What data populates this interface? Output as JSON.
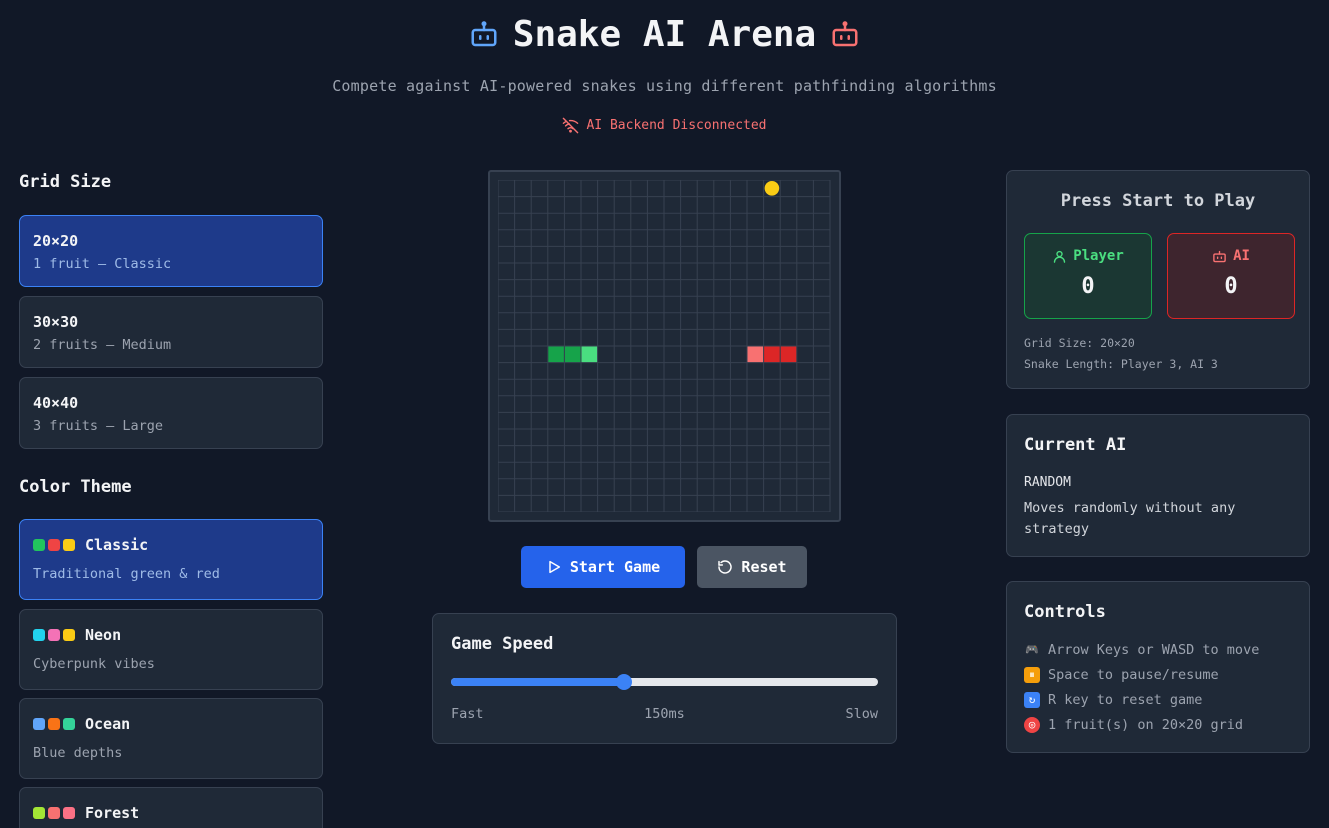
{
  "header": {
    "title": "Snake AI Arena",
    "subtitle": "Compete against AI-powered snakes using different pathfinding algorithms",
    "status": "AI Backend Disconnected",
    "left_icon": "robot-icon",
    "right_icon": "robot-icon",
    "status_icon": "disconnected-icon"
  },
  "grid_size": {
    "heading": "Grid Size",
    "options": [
      {
        "label": "20×20",
        "desc": "1 fruit – Classic",
        "selected": true
      },
      {
        "label": "30×30",
        "desc": "2 fruits – Medium",
        "selected": false
      },
      {
        "label": "40×40",
        "desc": "3 fruits – Large",
        "selected": false
      }
    ]
  },
  "color_theme": {
    "heading": "Color Theme",
    "options": [
      {
        "label": "Classic",
        "desc": "Traditional green & red",
        "selected": true,
        "colors": [
          "#22c55e",
          "#ef4444",
          "#facc15"
        ]
      },
      {
        "label": "Neon",
        "desc": "Cyberpunk vibes",
        "selected": false,
        "colors": [
          "#22d3ee",
          "#f472b6",
          "#facc15"
        ]
      },
      {
        "label": "Ocean",
        "desc": "Blue depths",
        "selected": false,
        "colors": [
          "#60a5fa",
          "#f97316",
          "#34d399"
        ]
      },
      {
        "label": "Forest",
        "desc": "",
        "selected": false,
        "colors": [
          "#a3e635",
          "#f87171",
          "#fb7185"
        ]
      }
    ]
  },
  "board": {
    "grid": 20,
    "fruit": {
      "col": 16,
      "row": 0,
      "color": "#facc15"
    },
    "player_snake": {
      "cells": [
        [
          3,
          10
        ],
        [
          4,
          10
        ],
        [
          5,
          10
        ]
      ],
      "color": "#16a34a",
      "head_color": "#4ade80"
    },
    "ai_snake": {
      "cells": [
        [
          15,
          10
        ],
        [
          16,
          10
        ],
        [
          17,
          10
        ]
      ],
      "color": "#dc2626",
      "head_color": "#f87171"
    }
  },
  "controls_bar": {
    "start_label": "Start Game",
    "reset_label": "Reset",
    "start_icon": "play-icon",
    "reset_icon": "rotate-icon"
  },
  "speed": {
    "heading": "Game Speed",
    "value_label": "150ms",
    "fast_label": "Fast",
    "slow_label": "Slow",
    "position": 0.405
  },
  "score": {
    "heading": "Press Start to Play",
    "player_label": "Player",
    "player_score": "0",
    "ai_label": "AI",
    "ai_score": "0",
    "grid_info": "Grid Size: 20×20",
    "length_info": "Snake Length: Player 3, AI 3"
  },
  "current_ai": {
    "heading": "Current AI",
    "name": "RANDOM",
    "desc": "Moves randomly without any strategy"
  },
  "controls": {
    "heading": "Controls",
    "items": [
      {
        "icon": "gamepad-icon",
        "text": "Arrow Keys or WASD to move"
      },
      {
        "icon": "pause-icon",
        "text": "Space to pause/resume"
      },
      {
        "icon": "repeat-icon",
        "text": "R key to reset game"
      },
      {
        "icon": "target-icon",
        "text": "1 fruit(s) on 20×20 grid"
      }
    ]
  }
}
